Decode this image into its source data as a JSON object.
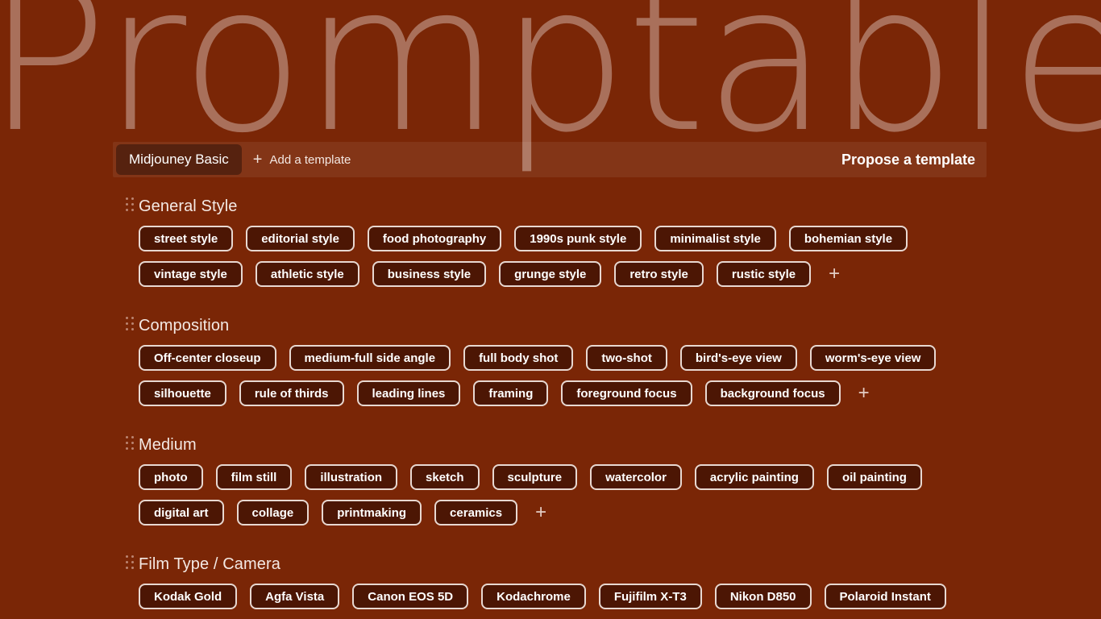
{
  "watermark": {
    "text": "Promptable"
  },
  "colors": {
    "background": "#7a2606",
    "chip_fill": "#4c1604",
    "chip_border": "#e8d8d1",
    "text": "#ffffff",
    "watermark": "#a9705b",
    "handle_dot": "#bb8571"
  },
  "tabbar": {
    "tabs": [
      {
        "label": "Midjouney Basic",
        "active": true
      }
    ],
    "add_template_label": "Add a template",
    "add_template_icon": "plus-icon",
    "propose_label": "Propose a template"
  },
  "sections": [
    {
      "title": "General Style",
      "handle_icon": "drag-handle-icon",
      "rows": [
        {
          "chips": [
            "street style",
            "editorial style",
            "food photography",
            "1990s punk style",
            "minimalist style",
            "bohemian style"
          ],
          "add": false
        },
        {
          "chips": [
            "vintage style",
            "athletic style",
            "business style",
            "grunge style",
            "retro style",
            "rustic style"
          ],
          "add": true,
          "add_label": "+"
        }
      ]
    },
    {
      "title": "Composition",
      "handle_icon": "drag-handle-icon",
      "rows": [
        {
          "chips": [
            "Off-center closeup",
            "medium-full side angle",
            "full body shot",
            "two-shot",
            "bird's-eye view",
            "worm's-eye view"
          ],
          "add": false
        },
        {
          "chips": [
            "silhouette",
            "rule of thirds",
            "leading lines",
            "framing",
            "foreground focus",
            "background focus"
          ],
          "add": true,
          "add_label": "+"
        }
      ]
    },
    {
      "title": "Medium",
      "handle_icon": "drag-handle-icon",
      "rows": [
        {
          "chips": [
            "photo",
            "film still",
            "illustration",
            "sketch",
            "sculpture",
            "watercolor",
            "acrylic painting",
            "oil painting"
          ],
          "add": false
        },
        {
          "chips": [
            "digital art",
            "collage",
            "printmaking",
            "ceramics"
          ],
          "add": true,
          "add_label": "+"
        }
      ]
    },
    {
      "title": "Film Type / Camera",
      "handle_icon": "drag-handle-icon",
      "rows": [
        {
          "chips": [
            "Kodak Gold",
            "Agfa Vista",
            "Canon EOS 5D",
            "Kodachrome",
            "Fujifilm X-T3",
            "Nikon D850",
            "Polaroid Instant"
          ],
          "add": false
        }
      ]
    }
  ]
}
